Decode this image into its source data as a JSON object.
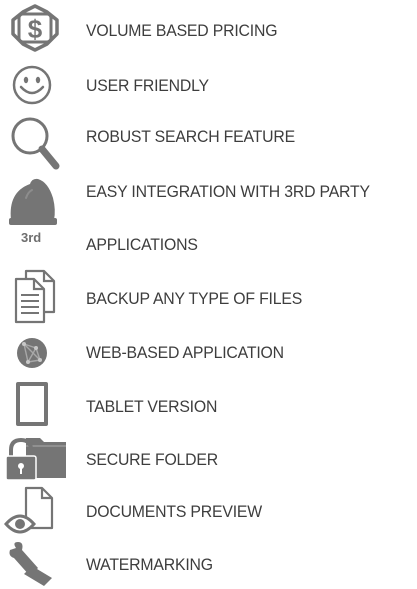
{
  "features": [
    {
      "label": "VOLUME BASED PRICING",
      "icon": "dollar-badge-icon"
    },
    {
      "label": "USER FRIENDLY",
      "icon": "smiley-icon"
    },
    {
      "label": "ROBUST SEARCH FEATURE",
      "icon": "magnifier-icon"
    },
    {
      "label": "EASY INTEGRATION WITH 3RD PARTY",
      "icon": "hardhat-3rd-icon"
    },
    {
      "label": "APPLICATIONS",
      "icon": "hardhat-3rd-icon"
    },
    {
      "label": "BACKUP ANY TYPE OF FILES",
      "icon": "documents-icon"
    },
    {
      "label": "WEB-BASED APPLICATION",
      "icon": "globe-network-icon"
    },
    {
      "label": "TABLET VERSION",
      "icon": "tablet-icon"
    },
    {
      "label": "SECURE FOLDER",
      "icon": "locked-folder-icon"
    },
    {
      "label": "DOCUMENTS PREVIEW",
      "icon": "eye-document-icon"
    },
    {
      "label": "WATERMARKING",
      "icon": "stamp-icon"
    }
  ],
  "icon_badge_text": "3rd",
  "colors": {
    "icon": "#757575",
    "text": "#3d3d3d"
  }
}
